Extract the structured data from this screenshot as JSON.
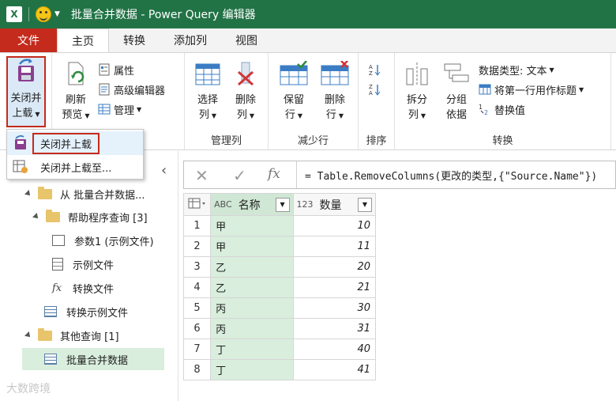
{
  "app": {
    "icon_letter": "X",
    "title": "批量合并数据 - Power Query 编辑器"
  },
  "tabs": [
    {
      "label": "文件"
    },
    {
      "label": "主页"
    },
    {
      "label": "转换"
    },
    {
      "label": "添加列"
    },
    {
      "label": "视图"
    }
  ],
  "ribbon": {
    "close_load": {
      "line1": "关闭并",
      "line2": "上载"
    },
    "refresh": {
      "line1": "刷新",
      "line2": "预览"
    },
    "properties": "属性",
    "advanced_editor": "高级编辑器",
    "manage": "管理",
    "choose_cols": {
      "line1": "选择",
      "line2": "列"
    },
    "remove_cols": {
      "line1": "删除",
      "line2": "列"
    },
    "group_manage_cols": "管理列",
    "keep_rows": {
      "line1": "保留",
      "line2": "行"
    },
    "remove_rows": {
      "line1": "删除",
      "line2": "行"
    },
    "group_reduce_rows": "减少行",
    "group_sort": "排序",
    "split_col": {
      "line1": "拆分",
      "line2": "列"
    },
    "group_by": {
      "line1": "分组",
      "line2": "依据"
    },
    "data_type": "数据类型: 文本",
    "first_row_header": "将第一行用作标题",
    "replace_values": "替换值",
    "group_transform": "转换"
  },
  "dropdown": {
    "items": [
      {
        "label": "关闭并上载"
      },
      {
        "label": "关闭并上载至..."
      }
    ]
  },
  "tree": {
    "from_folder": "从 批量合并数据...",
    "helper_queries": "帮助程序查询 [3]",
    "param": "参数1 (示例文件)",
    "sample_file": "示例文件",
    "transform_file": "转换文件",
    "transform_sample": "转换示例文件",
    "other_queries": "其他查询 [1]",
    "batch_merge": "批量合并数据"
  },
  "formula": {
    "text": "= Table.RemoveColumns(更改的类型,{\"Source.Name\"})"
  },
  "grid": {
    "type_name": "ABC",
    "col_name": "名称",
    "type_qty": "123",
    "col_qty": "数量",
    "rows": [
      {
        "n": "1",
        "name": "甲",
        "qty": "10"
      },
      {
        "n": "2",
        "name": "甲",
        "qty": "11"
      },
      {
        "n": "3",
        "name": "乙",
        "qty": "20"
      },
      {
        "n": "4",
        "name": "乙",
        "qty": "21"
      },
      {
        "n": "5",
        "name": "丙",
        "qty": "30"
      },
      {
        "n": "6",
        "name": "丙",
        "qty": "31"
      },
      {
        "n": "7",
        "name": "丁",
        "qty": "40"
      },
      {
        "n": "8",
        "name": "丁",
        "qty": "41"
      }
    ]
  },
  "watermark": "大数跨境",
  "colors": {
    "excel_green": "#217346",
    "file_red": "#c42b1c",
    "highlight": "#c42b1c"
  }
}
